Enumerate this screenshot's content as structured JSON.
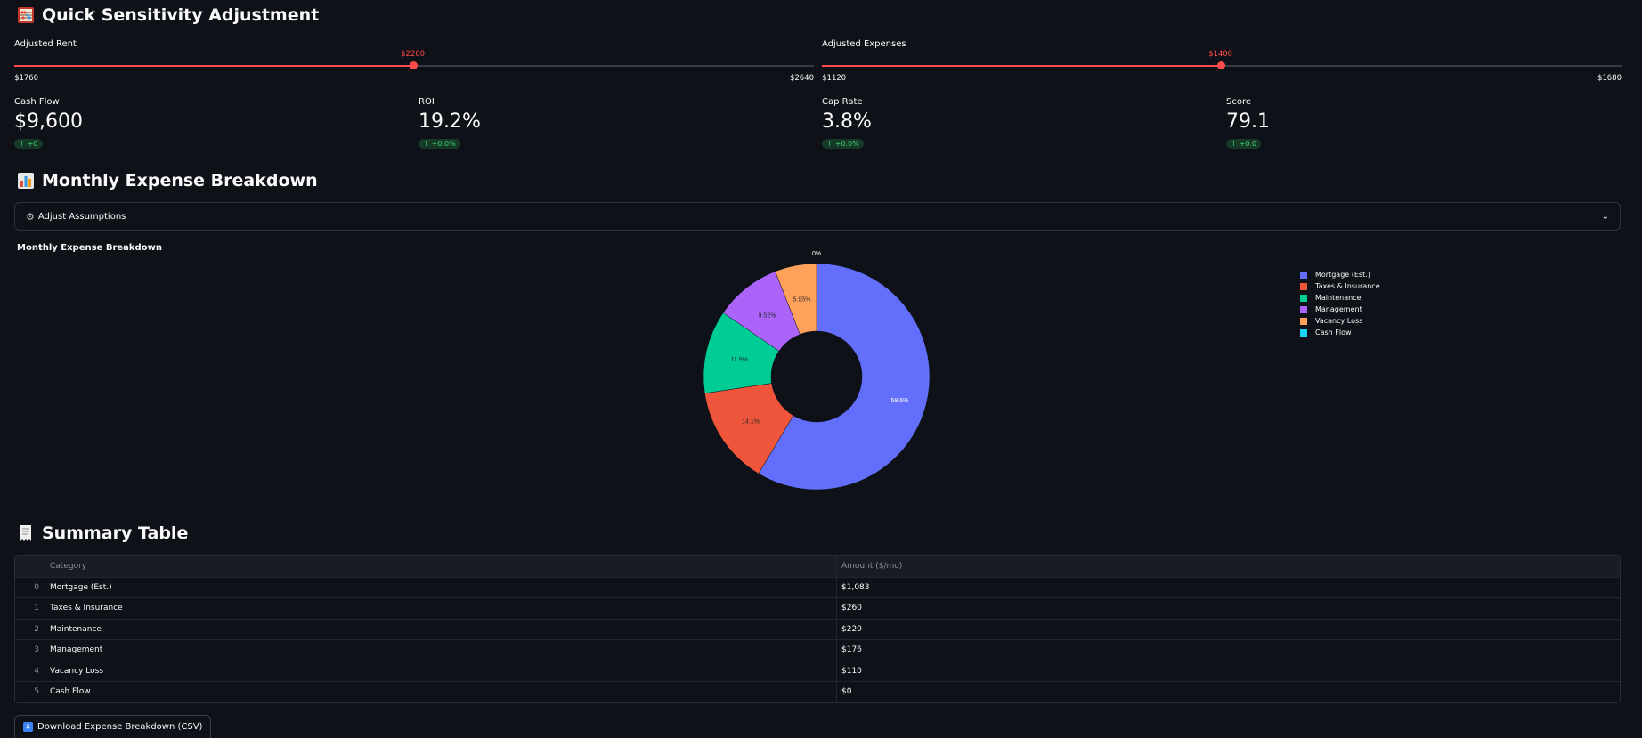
{
  "sensitivity": {
    "title": "Quick Sensitivity Adjustment",
    "rent": {
      "label": "Adjusted Rent",
      "value": "$2200",
      "min": "$1760",
      "max": "$2640",
      "fraction": 0.5
    },
    "expenses": {
      "label": "Adjusted Expenses",
      "value": "$1400",
      "min": "$1120",
      "max": "$1680",
      "fraction": 0.5
    }
  },
  "metrics": [
    {
      "label": "Cash Flow",
      "value": "$9,600",
      "delta": "+0"
    },
    {
      "label": "ROI",
      "value": "19.2%",
      "delta": "+0.0%"
    },
    {
      "label": "Cap Rate",
      "value": "3.8%",
      "delta": "+0.0%"
    },
    {
      "label": "Score",
      "value": "79.1",
      "delta": "+0.0"
    }
  ],
  "breakdown": {
    "title": "Monthly Expense Breakdown",
    "expander_label": "Adjust Assumptions"
  },
  "chart_data": {
    "type": "pie",
    "title": "Monthly Expense Breakdown",
    "hole": true,
    "categories": [
      "Mortgage (Est.)",
      "Taxes & Insurance",
      "Maintenance",
      "Management",
      "Vacancy Loss",
      "Cash Flow"
    ],
    "values": [
      1083,
      260,
      220,
      176,
      110,
      0
    ],
    "percent_labels": [
      "58.6%",
      "14.1%",
      "11.9%",
      "9.52%",
      "5.95%",
      "0%"
    ],
    "colors": [
      "#636efa",
      "#ef553b",
      "#00cc96",
      "#ab63fa",
      "#ffa15a",
      "#19d3f3"
    ],
    "legend_position": "right"
  },
  "summary": {
    "title": "Summary Table",
    "columns": [
      "Category",
      "Amount ($/mo)"
    ],
    "rows": [
      {
        "idx": "0",
        "category": "Mortgage (Est.)",
        "amount": "$1,083"
      },
      {
        "idx": "1",
        "category": "Taxes & Insurance",
        "amount": "$260"
      },
      {
        "idx": "2",
        "category": "Maintenance",
        "amount": "$220"
      },
      {
        "idx": "3",
        "category": "Management",
        "amount": "$176"
      },
      {
        "idx": "4",
        "category": "Vacancy Loss",
        "amount": "$110"
      },
      {
        "idx": "5",
        "category": "Cash Flow",
        "amount": "$0"
      }
    ]
  },
  "download_label": "Download Expense Breakdown (CSV)"
}
